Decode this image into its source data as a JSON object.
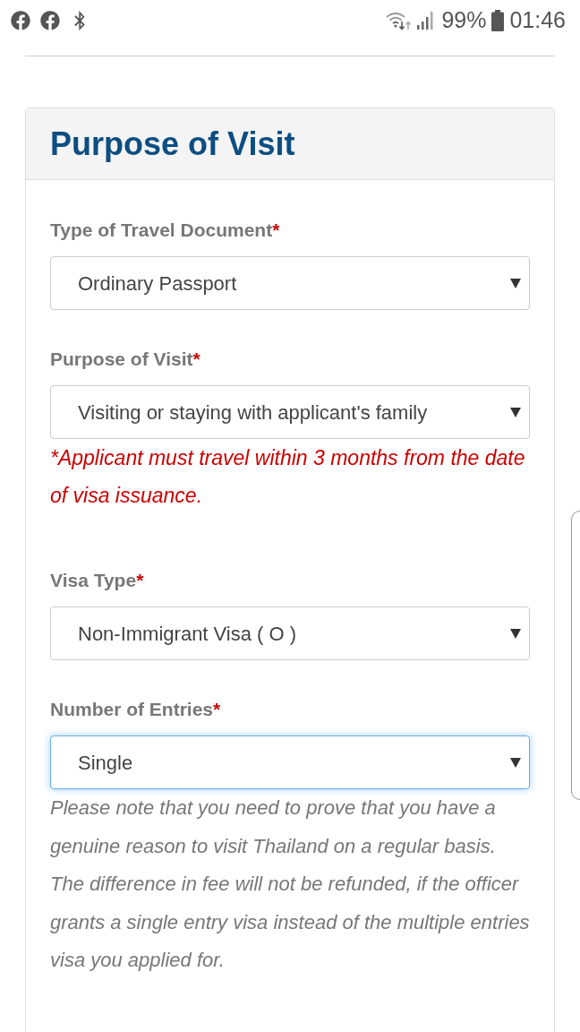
{
  "status_bar": {
    "battery": "99%",
    "time": "01:46"
  },
  "section": {
    "title": "Purpose of Visit",
    "fields": [
      {
        "label": "Type of Travel Document",
        "required_mark": "*",
        "value": "Ordinary Passport",
        "focused": false
      },
      {
        "label": "Purpose of Visit",
        "required_mark": "*",
        "value": "Visiting or staying with applicant's family",
        "focused": false,
        "note": {
          "kind": "warning",
          "text": "*Applicant must travel within 3 months from the date of visa issuance."
        }
      },
      {
        "label": "Visa Type",
        "required_mark": "*",
        "value": "Non-Immigrant Visa ( O )",
        "focused": false
      },
      {
        "label": "Number of Entries",
        "required_mark": "*",
        "value": "Single",
        "focused": true,
        "note": {
          "kind": "help",
          "text": "Please note that you need to prove that you have a genuine reason to visit Thailand on a regular basis. The difference in fee will not be refunded, if the officer grants a single entry visa instead of the multiple entries visa you applied for."
        }
      }
    ]
  }
}
